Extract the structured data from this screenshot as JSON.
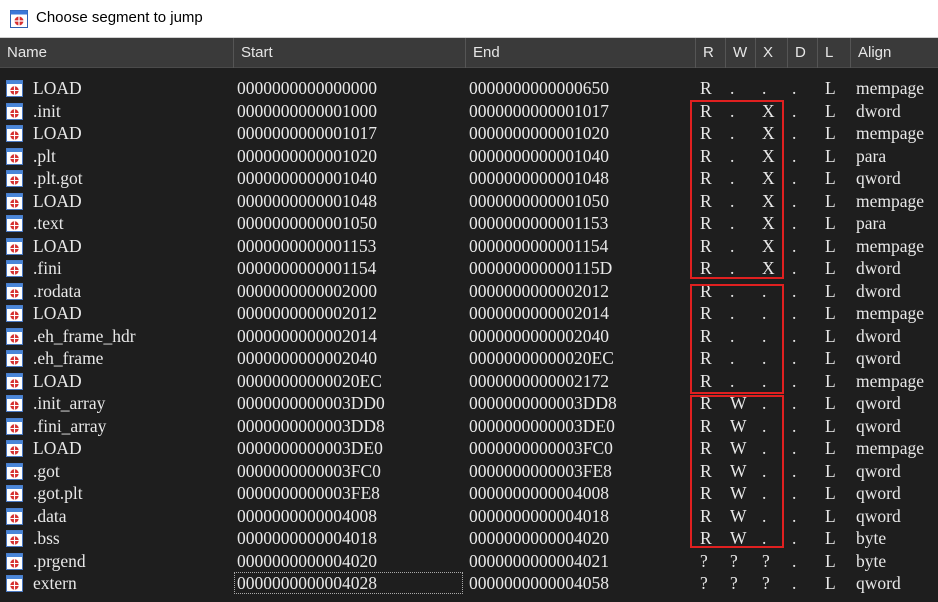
{
  "window": {
    "title": "Choose segment to jump"
  },
  "columns": {
    "name": "Name",
    "start": "Start",
    "end": "End",
    "r": "R",
    "w": "W",
    "x": "X",
    "d": "D",
    "l": "L",
    "align": "Align"
  },
  "colors": {
    "background": "#1e1e1e",
    "header": "#3a3a3a",
    "text": "#e8e8e8",
    "highlight_box": "#e02020"
  },
  "rows": [
    {
      "name": "LOAD",
      "start": "0000000000000000",
      "end": "0000000000000650",
      "r": "R",
      "w": ".",
      "x": ".",
      "d": ".",
      "l": "L",
      "align": "mempage"
    },
    {
      "name": ".init",
      "start": "0000000000001000",
      "end": "0000000000001017",
      "r": "R",
      "w": ".",
      "x": "X",
      "d": ".",
      "l": "L",
      "align": "dword"
    },
    {
      "name": "LOAD",
      "start": "0000000000001017",
      "end": "0000000000001020",
      "r": "R",
      "w": ".",
      "x": "X",
      "d": ".",
      "l": "L",
      "align": "mempage"
    },
    {
      "name": ".plt",
      "start": "0000000000001020",
      "end": "0000000000001040",
      "r": "R",
      "w": ".",
      "x": "X",
      "d": ".",
      "l": "L",
      "align": "para"
    },
    {
      "name": ".plt.got",
      "start": "0000000000001040",
      "end": "0000000000001048",
      "r": "R",
      "w": ".",
      "x": "X",
      "d": ".",
      "l": "L",
      "align": "qword"
    },
    {
      "name": "LOAD",
      "start": "0000000000001048",
      "end": "0000000000001050",
      "r": "R",
      "w": ".",
      "x": "X",
      "d": ".",
      "l": "L",
      "align": "mempage"
    },
    {
      "name": ".text",
      "start": "0000000000001050",
      "end": "0000000000001153",
      "r": "R",
      "w": ".",
      "x": "X",
      "d": ".",
      "l": "L",
      "align": "para"
    },
    {
      "name": "LOAD",
      "start": "0000000000001153",
      "end": "0000000000001154",
      "r": "R",
      "w": ".",
      "x": "X",
      "d": ".",
      "l": "L",
      "align": "mempage"
    },
    {
      "name": ".fini",
      "start": "0000000000001154",
      "end": "000000000000115D",
      "r": "R",
      "w": ".",
      "x": "X",
      "d": ".",
      "l": "L",
      "align": "dword"
    },
    {
      "name": ".rodata",
      "start": "0000000000002000",
      "end": "0000000000002012",
      "r": "R",
      "w": ".",
      "x": ".",
      "d": ".",
      "l": "L",
      "align": "dword"
    },
    {
      "name": "LOAD",
      "start": "0000000000002012",
      "end": "0000000000002014",
      "r": "R",
      "w": ".",
      "x": ".",
      "d": ".",
      "l": "L",
      "align": "mempage"
    },
    {
      "name": ".eh_frame_hdr",
      "start": "0000000000002014",
      "end": "0000000000002040",
      "r": "R",
      "w": ".",
      "x": ".",
      "d": ".",
      "l": "L",
      "align": "dword"
    },
    {
      "name": ".eh_frame",
      "start": "0000000000002040",
      "end": "00000000000020EC",
      "r": "R",
      "w": ".",
      "x": ".",
      "d": ".",
      "l": "L",
      "align": "qword"
    },
    {
      "name": "LOAD",
      "start": "00000000000020EC",
      "end": "0000000000002172",
      "r": "R",
      "w": ".",
      "x": ".",
      "d": ".",
      "l": "L",
      "align": "mempage"
    },
    {
      "name": ".init_array",
      "start": "0000000000003DD0",
      "end": "0000000000003DD8",
      "r": "R",
      "w": "W",
      "x": ".",
      "d": ".",
      "l": "L",
      "align": "qword"
    },
    {
      "name": ".fini_array",
      "start": "0000000000003DD8",
      "end": "0000000000003DE0",
      "r": "R",
      "w": "W",
      "x": ".",
      "d": ".",
      "l": "L",
      "align": "qword"
    },
    {
      "name": "LOAD",
      "start": "0000000000003DE0",
      "end": "0000000000003FC0",
      "r": "R",
      "w": "W",
      "x": ".",
      "d": ".",
      "l": "L",
      "align": "mempage"
    },
    {
      "name": ".got",
      "start": "0000000000003FC0",
      "end": "0000000000003FE8",
      "r": "R",
      "w": "W",
      "x": ".",
      "d": ".",
      "l": "L",
      "align": "qword"
    },
    {
      "name": ".got.plt",
      "start": "0000000000003FE8",
      "end": "0000000000004008",
      "r": "R",
      "w": "W",
      "x": ".",
      "d": ".",
      "l": "L",
      "align": "qword"
    },
    {
      "name": ".data",
      "start": "0000000000004008",
      "end": "0000000000004018",
      "r": "R",
      "w": "W",
      "x": ".",
      "d": ".",
      "l": "L",
      "align": "qword"
    },
    {
      "name": ".bss",
      "start": "0000000000004018",
      "end": "0000000000004020",
      "r": "R",
      "w": "W",
      "x": ".",
      "d": ".",
      "l": "L",
      "align": "byte"
    },
    {
      "name": ".prgend",
      "start": "0000000000004020",
      "end": "0000000000004021",
      "r": "?",
      "w": "?",
      "x": "?",
      "d": ".",
      "l": "L",
      "align": "byte"
    },
    {
      "name": "extern",
      "start": "0000000000004028",
      "end": "0000000000004058",
      "r": "?",
      "w": "?",
      "x": "?",
      "d": ".",
      "l": "L",
      "align": "qword"
    }
  ]
}
